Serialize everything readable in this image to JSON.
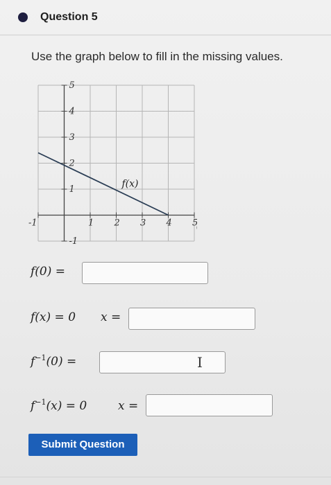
{
  "question": {
    "title": "Question 5"
  },
  "instruction": "Use the graph below to fill in the missing values.",
  "graph": {
    "function_label": "f(x)",
    "x_tick_labels": [
      "-1",
      "1",
      "2",
      "3",
      "4",
      "5"
    ],
    "y_tick_labels": [
      "5",
      "4",
      "3",
      "2",
      "1",
      "-1"
    ]
  },
  "chart_data": {
    "type": "line",
    "series": [
      {
        "name": "f(x)",
        "x": [
          -1,
          4
        ],
        "y": [
          2.4,
          0
        ]
      }
    ],
    "xlim": [
      -1,
      5
    ],
    "ylim": [
      -1,
      5
    ],
    "grid": true
  },
  "prompts": {
    "p1": {
      "lhs": "f(0) ="
    },
    "p2": {
      "lhs": "f(x) = 0",
      "rhs": "x ="
    },
    "p3": {
      "fn": "f",
      "sup": "−1",
      "rest": "(0) ="
    },
    "p4": {
      "fn": "f",
      "sup": "−1",
      "rest": "(x) = 0",
      "rhs": "x ="
    }
  },
  "inputs": {
    "value1": "",
    "value2": "",
    "value3": "",
    "value4": ""
  },
  "submit": {
    "label": "Submit Question"
  },
  "icons": {
    "bullet": "bullet-dot-icon",
    "cursor": "text-cursor-icon"
  },
  "colors": {
    "accent": "#1c5fb8",
    "bullet": "#1e1e40"
  }
}
